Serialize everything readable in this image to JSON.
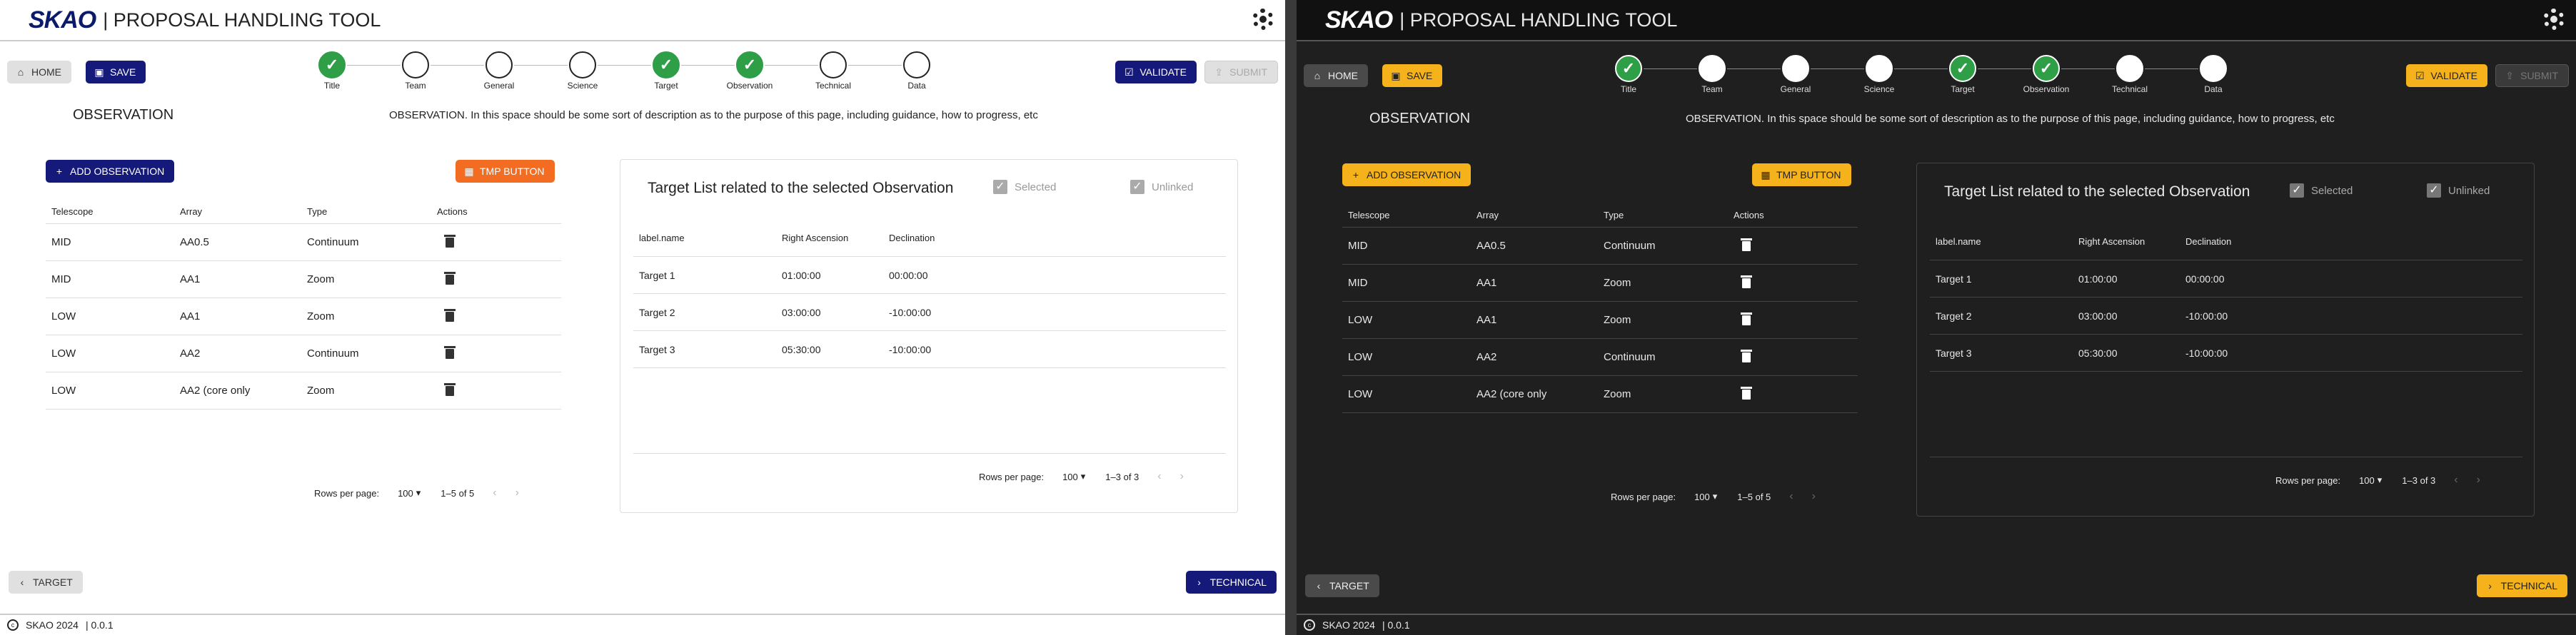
{
  "app": {
    "logo": "SKAO",
    "title": "| PROPOSAL HANDLING TOOL"
  },
  "buttons": {
    "home": "HOME",
    "save": "SAVE",
    "validate": "VALIDATE",
    "submit": "SUBMIT",
    "add_observation": "ADD OBSERVATION",
    "tmp_button": "TMP BUTTON",
    "back": "TARGET",
    "next": "TECHNICAL"
  },
  "steps": [
    "Title",
    "Team",
    "General",
    "Science",
    "Target",
    "Observation",
    "Technical",
    "Data"
  ],
  "steps_done": [
    true,
    false,
    false,
    false,
    true,
    true,
    false,
    false
  ],
  "page": {
    "title": "OBSERVATION",
    "description": "OBSERVATION. In this space should be some sort of description as to the purpose of this page, including guidance, how to progress, etc"
  },
  "obs_table": {
    "headers": [
      "Telescope",
      "Array",
      "Type",
      "Actions"
    ],
    "rows": [
      [
        "MID",
        "AA0.5",
        "Continuum"
      ],
      [
        "MID",
        "AA1",
        "Zoom"
      ],
      [
        "LOW",
        "AA1",
        "Zoom"
      ],
      [
        "LOW",
        "AA2",
        "Continuum"
      ],
      [
        "LOW",
        "AA2 (core only",
        "Zoom"
      ]
    ],
    "rows_per_page_label": "Rows per page:",
    "rows_per_page": "100",
    "range": "1–5 of 5"
  },
  "target_card": {
    "title": "Target List related to the selected Observation",
    "selected_label": "Selected",
    "unlinked_label": "Unlinked",
    "headers": [
      "label.name",
      "Right Ascension",
      "Declination"
    ],
    "rows": [
      [
        "Target 1",
        "01:00:00",
        "00:00:00"
      ],
      [
        "Target 2",
        "03:00:00",
        "-10:00:00"
      ],
      [
        "Target 3",
        "05:30:00",
        "-10:00:00"
      ]
    ],
    "rows_per_page_label": "Rows per page:",
    "rows_per_page": "100",
    "range": "1–3 of 3"
  },
  "footer": {
    "copyright": "SKAO 2024",
    "version": "| 0.0.1"
  },
  "icons": {
    "home": "home-icon",
    "save": "save-icon",
    "validate": "validate-icon",
    "submit": "submit-icon",
    "add": "plus-icon",
    "tmp": "grid-icon",
    "delete": "trash-icon",
    "settings": "gear-icon",
    "back": "chevron-left-icon",
    "next": "chevron-right-icon",
    "copyright": "copyright-icon"
  },
  "themes": {
    "light": {
      "primary": "#14197a",
      "accent": "#f26d21",
      "step_done": "#2e9e47"
    },
    "dark": {
      "primary": "#f5b21a",
      "accent": "#f5b21a",
      "step_done": "#2e9e47"
    }
  }
}
